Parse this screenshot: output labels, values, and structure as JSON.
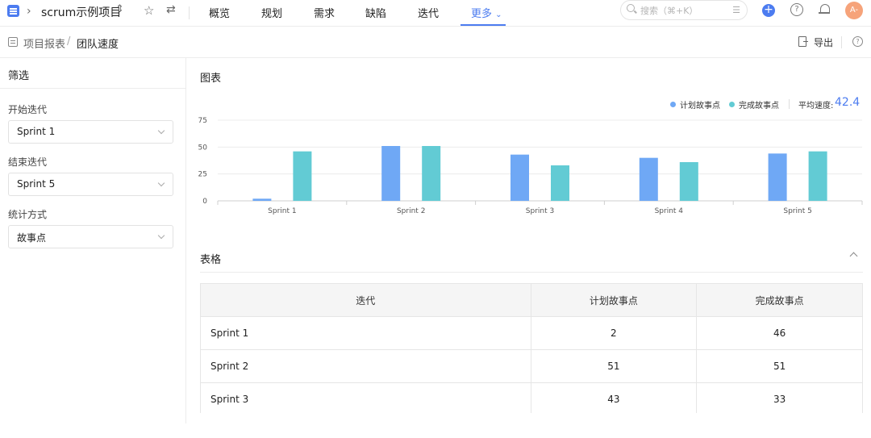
{
  "topnav": {
    "project_name": "scrum示例项目",
    "tabs": [
      "概览",
      "规划",
      "需求",
      "缺陷",
      "迭代",
      "更多"
    ],
    "active_tab": "更多",
    "search_placeholder": "搜索（⌘+K）",
    "avatar_text": "A-",
    "accent": "#4c7cf0"
  },
  "breadcrumb": {
    "parent": "项目报表",
    "separator": "/",
    "current": "团队速度",
    "export_label": "导出"
  },
  "sidebar": {
    "title": "筛选",
    "fields": [
      {
        "label": "开始迭代",
        "value": "Sprint 1"
      },
      {
        "label": "结束迭代",
        "value": "Sprint 5"
      },
      {
        "label": "统计方式",
        "value": "故事点"
      }
    ]
  },
  "chart_section": {
    "title": "图表",
    "avg_label": "平均速度:",
    "avg_value": "42.4"
  },
  "chart_data": {
    "type": "bar",
    "categories": [
      "Sprint 1",
      "Sprint 2",
      "Sprint 3",
      "Sprint 4",
      "Sprint 5"
    ],
    "series": [
      {
        "name": "计划故事点",
        "values": [
          2,
          51,
          43,
          40,
          44
        ],
        "color": "#6fa8f5"
      },
      {
        "name": "完成故事点",
        "values": [
          46,
          51,
          33,
          36,
          46
        ],
        "color": "#62cbd4"
      }
    ],
    "yticks": [
      0,
      25,
      50,
      75
    ],
    "ylim": [
      0,
      75
    ],
    "grid": true,
    "legend": "top-right"
  },
  "table_section": {
    "title": "表格",
    "headers": [
      "迭代",
      "计划故事点",
      "完成故事点"
    ],
    "rows": [
      [
        "Sprint 1",
        "2",
        "46"
      ],
      [
        "Sprint 2",
        "51",
        "51"
      ],
      [
        "Sprint 3",
        "43",
        "33"
      ]
    ]
  }
}
